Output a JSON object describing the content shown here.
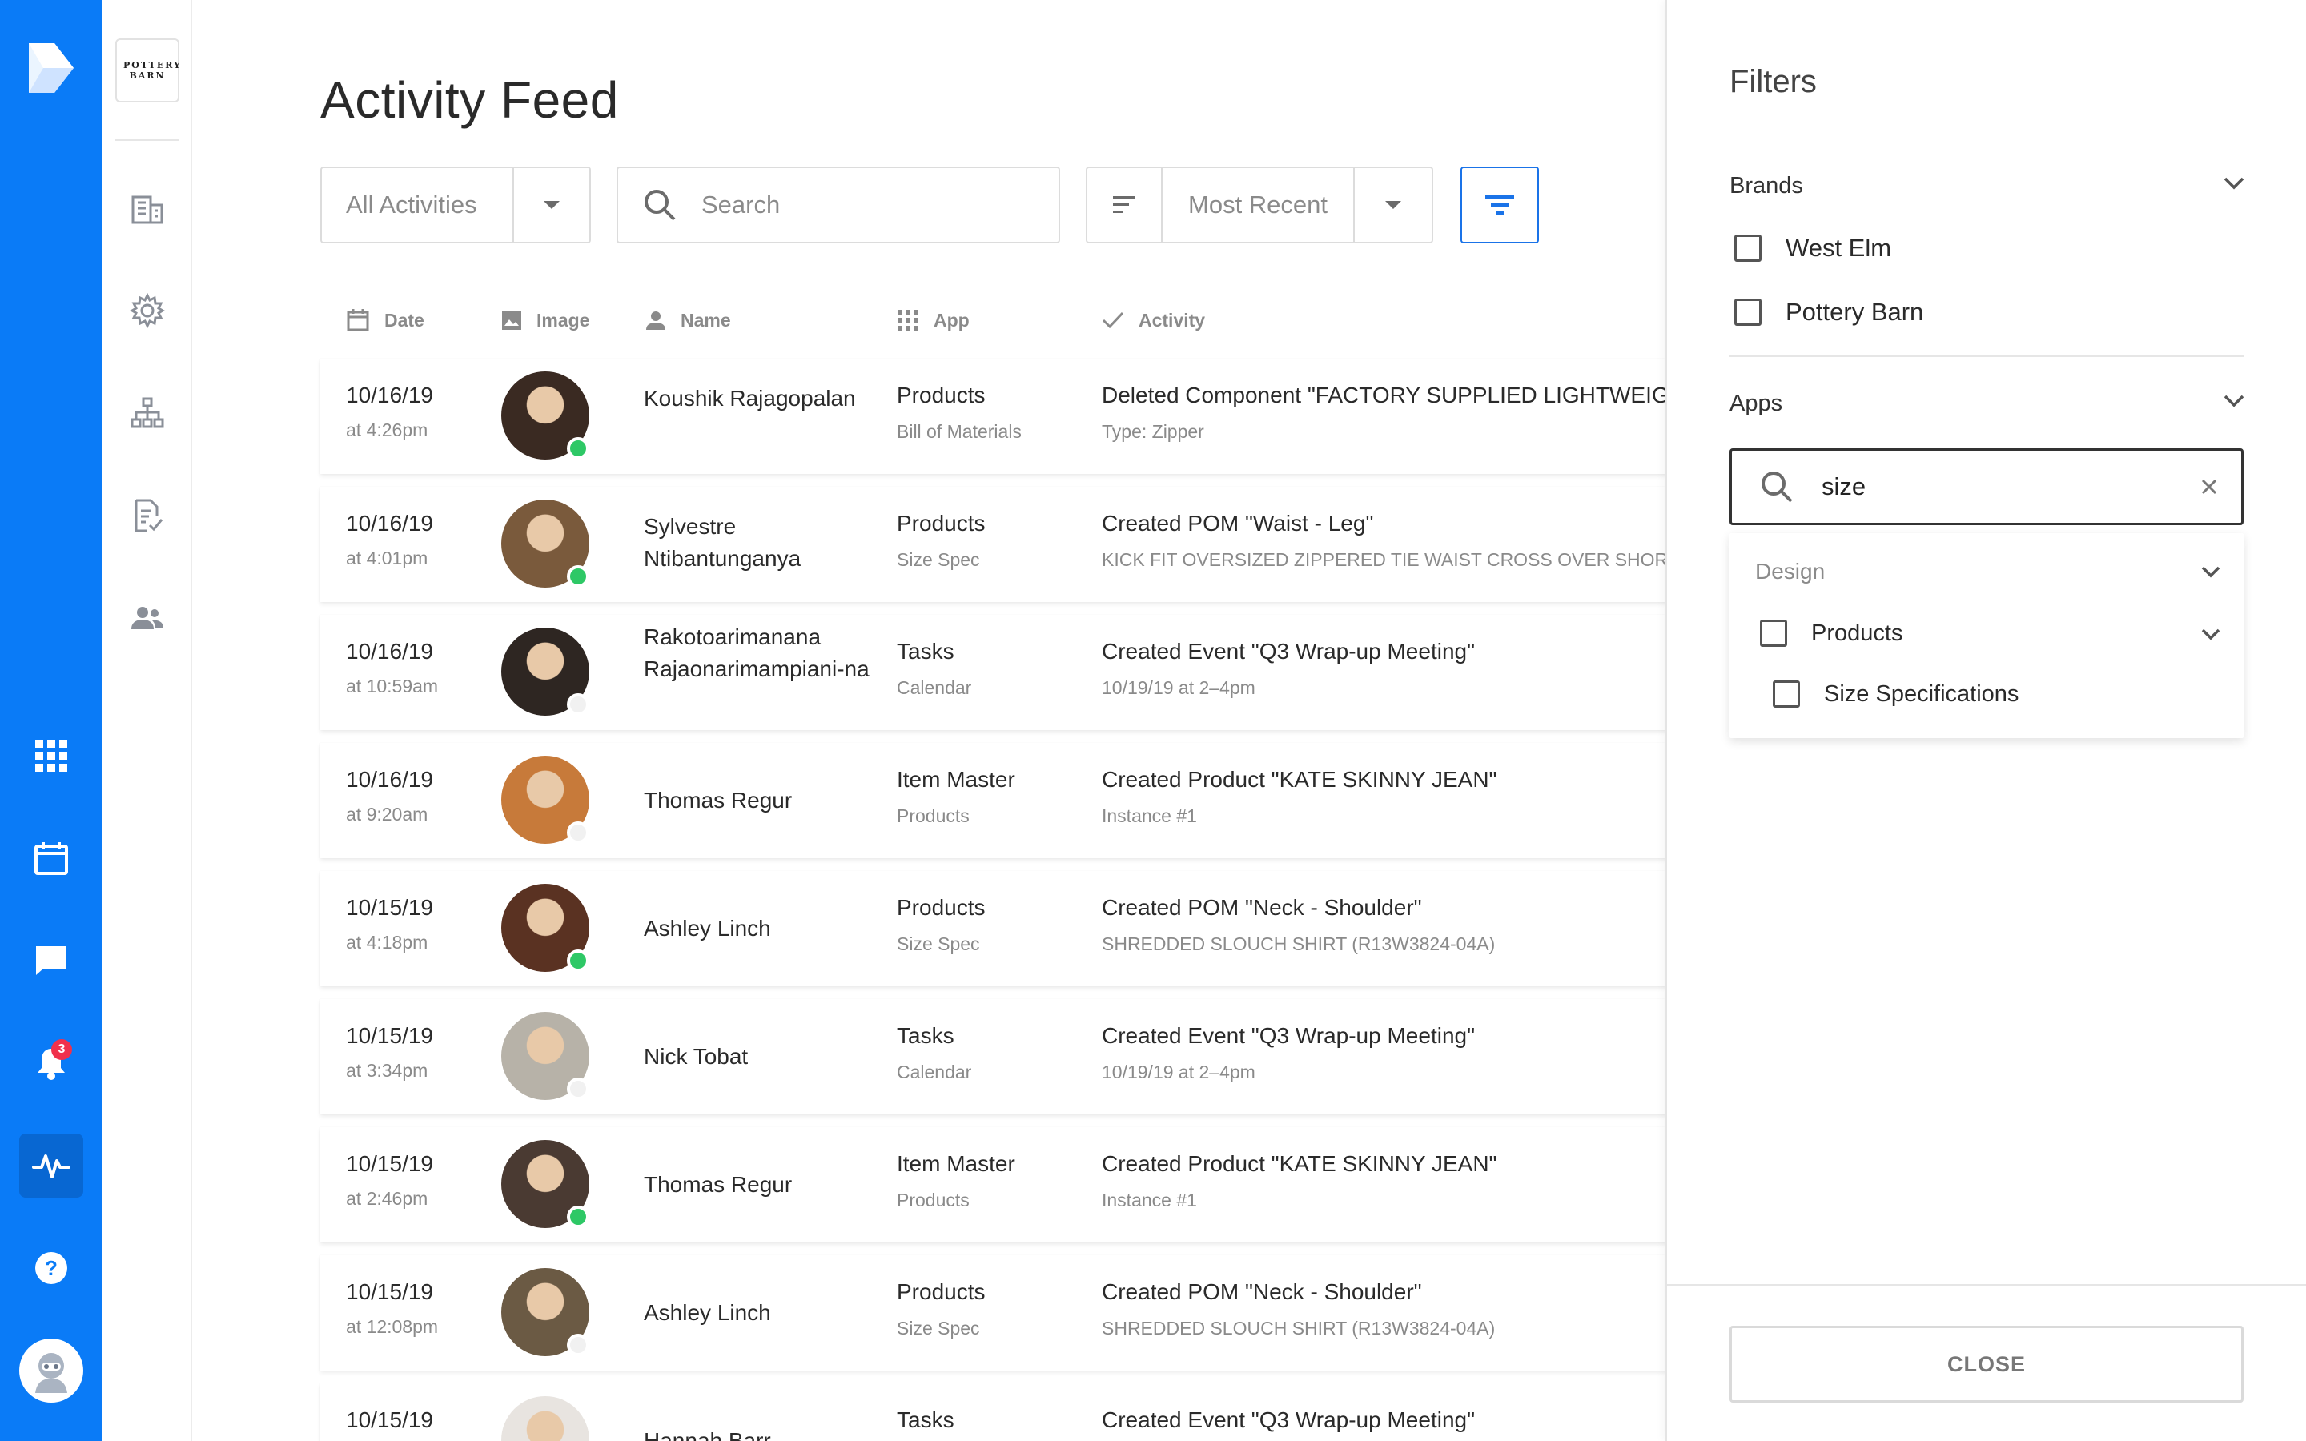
{
  "brand_tile_text": "POTTERY BARN",
  "rail": {
    "notification_count": "3"
  },
  "page": {
    "title": "Activity Feed"
  },
  "controls": {
    "activities_value": "All Activities",
    "search_placeholder": "Search",
    "sort_value": "Most Recent"
  },
  "columns": {
    "date": "Date",
    "image": "Image",
    "name": "Name",
    "app": "App",
    "activity": "Activity"
  },
  "rows": [
    {
      "date": "10/16/19",
      "time": "at 4:26pm",
      "name": "Koushik Rajagopalan",
      "app": "Products",
      "app_sub": "Bill of Materials",
      "activity": "Deleted Component \"FACTORY SUPPLIED LIGHTWEIGHT",
      "activity_sub": "Type: Zipper",
      "online": true,
      "avatar_color": "#3a2a22"
    },
    {
      "date": "10/16/19",
      "time": "at 4:01pm",
      "name": "Sylvestre Ntibantunganya",
      "app": "Products",
      "app_sub": "Size Spec",
      "activity": "Created POM \"Waist - Leg\"",
      "activity_sub": "KICK FIT OVERSIZED ZIPPERED TIE WAIST CROSS OVER SHORT_...",
      "online": true,
      "avatar_color": "#7a5a3c"
    },
    {
      "date": "10/16/19",
      "time": "at 10:59am",
      "name": "Rakotoarimanana Rajaonarimampiani-na",
      "app": "Tasks",
      "app_sub": "Calendar",
      "activity": "Created Event \"Q3 Wrap-up Meeting\"",
      "activity_sub": "10/19/19 at 2–4pm",
      "online": false,
      "avatar_color": "#2e2622"
    },
    {
      "date": "10/16/19",
      "time": "at 9:20am",
      "name": "Thomas Regur",
      "app": "Item Master",
      "app_sub": "Products",
      "activity": "Created Product \"KATE SKINNY JEAN\"",
      "activity_sub": "Instance #1",
      "online": false,
      "avatar_color": "#c77a3a"
    },
    {
      "date": "10/15/19",
      "time": "at 4:18pm",
      "name": "Ashley Linch",
      "app": "Products",
      "app_sub": "Size Spec",
      "activity": "Created POM \"Neck - Shoulder\"",
      "activity_sub": "SHREDDED SLOUCH SHIRT (R13W3824-04A)",
      "online": true,
      "avatar_color": "#5a3222"
    },
    {
      "date": "10/15/19",
      "time": "at 3:34pm",
      "name": "Nick Tobat",
      "app": "Tasks",
      "app_sub": "Calendar",
      "activity": "Created Event \"Q3 Wrap-up Meeting\"",
      "activity_sub": "10/19/19 at 2–4pm",
      "online": false,
      "avatar_color": "#b7b2a8"
    },
    {
      "date": "10/15/19",
      "time": "at 2:46pm",
      "name": "Thomas Regur",
      "app": "Item Master",
      "app_sub": "Products",
      "activity": "Created Product \"KATE SKINNY JEAN\"",
      "activity_sub": "Instance #1",
      "online": true,
      "avatar_color": "#4a3a32"
    },
    {
      "date": "10/15/19",
      "time": "at 12:08pm",
      "name": "Ashley Linch",
      "app": "Products",
      "app_sub": "Size Spec",
      "activity": "Created POM \"Neck - Shoulder\"",
      "activity_sub": "SHREDDED SLOUCH SHIRT (R13W3824-04A)",
      "online": false,
      "avatar_color": "#6b5a44"
    },
    {
      "date": "10/15/19",
      "time": "",
      "name": "Hannah Barr",
      "app": "Tasks",
      "app_sub": "",
      "activity": "Created Event \"Q3 Wrap-up Meeting\"",
      "activity_sub": "",
      "online": false,
      "avatar_color": "#e8e4e0"
    }
  ],
  "filters": {
    "title": "Filters",
    "brands_title": "Brands",
    "brands": [
      {
        "label": "West Elm",
        "checked": false
      },
      {
        "label": "Pottery Barn",
        "checked": false
      }
    ],
    "apps_title": "Apps",
    "apps_search_value": "size",
    "dropdown_group": "Design",
    "dropdown_items": [
      {
        "label": "Products",
        "checked": false
      },
      {
        "label": "Size Specifications",
        "checked": false
      }
    ],
    "close_label": "CLOSE"
  },
  "colors": {
    "rail": "#0a7bf7",
    "online": "#2ec866",
    "accent": "#1a73e8"
  }
}
